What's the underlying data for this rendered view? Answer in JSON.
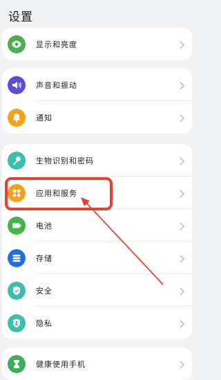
{
  "header": {
    "title": "设置"
  },
  "groups": [
    {
      "items": [
        {
          "label": "显示和亮度",
          "icon": "eye-icon",
          "color": "#4caf50"
        }
      ]
    },
    {
      "items": [
        {
          "label": "声音和振动",
          "icon": "speaker-icon",
          "color": "#5b4ddb"
        },
        {
          "label": "通知",
          "icon": "bell-icon",
          "color": "#f5a11a"
        }
      ]
    },
    {
      "items": [
        {
          "label": "生物识别和密码",
          "icon": "key-icon",
          "color": "#3bbfae"
        },
        {
          "label": "应用和服务",
          "icon": "apps-grid-icon",
          "color": "#f5a11a"
        },
        {
          "label": "电池",
          "icon": "battery-icon",
          "color": "#43b649"
        },
        {
          "label": "存储",
          "icon": "storage-icon",
          "color": "#1e6ee8"
        },
        {
          "label": "安全",
          "icon": "shield-icon",
          "color": "#3bbfae"
        },
        {
          "label": "隐私",
          "icon": "privacy-icon",
          "color": "#3bbfae"
        }
      ]
    },
    {
      "items": [
        {
          "label": "健康使用手机",
          "icon": "hourglass-icon",
          "color": "#3fae5a"
        }
      ]
    }
  ],
  "annotation": {
    "highlight_color": "#e8412c"
  }
}
